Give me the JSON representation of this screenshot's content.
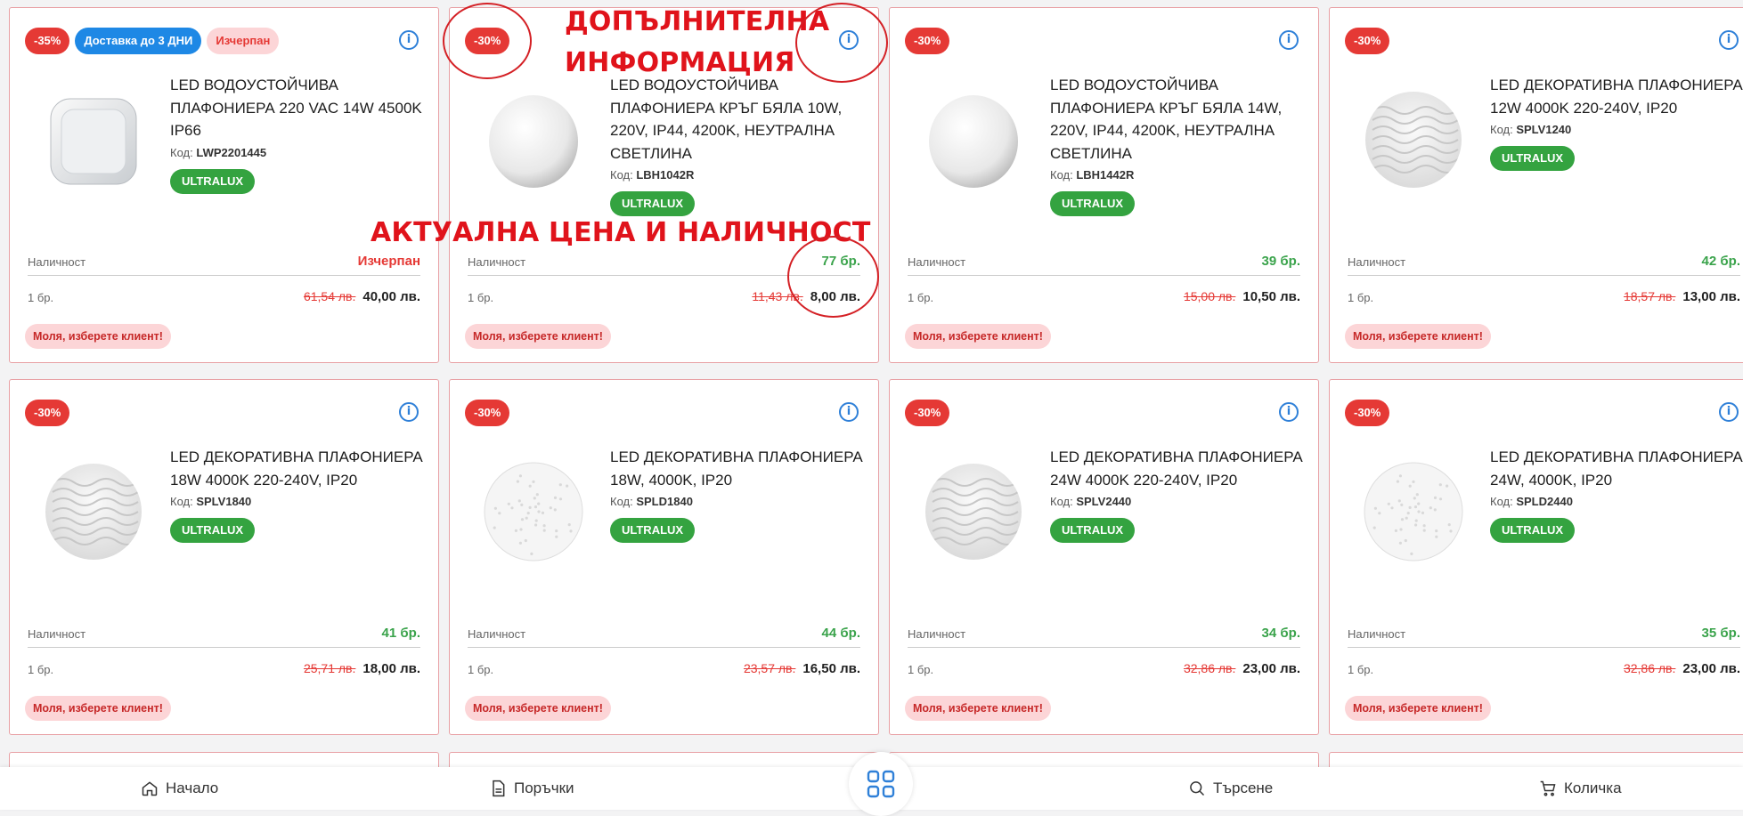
{
  "common": {
    "stock_label": "Наличност",
    "qty": "1 бр.",
    "client_prompt": "Моля, изберете клиент!",
    "code_label": "Код:",
    "info_glyph": "i"
  },
  "annotations": {
    "more_info": "ДОПЪЛНИТЕЛНА ИНФОРМАЦИЯ",
    "more_info_line1": "ДОПЪЛНИТЕЛНА",
    "more_info_line2": "ИНФОРМАЦИЯ",
    "price_stock": "АКТУАЛНА ЦЕНА И НАЛИЧНОСТ"
  },
  "products": [
    {
      "badges": [
        {
          "text": "-35%",
          "kind": "discount"
        },
        {
          "text": "Доставка до 3 ДНИ",
          "kind": "delivery"
        },
        {
          "text": "Изчерпан",
          "kind": "soldout"
        }
      ],
      "title": "LED ВОДОУСТОЙЧИВА ПЛАФОНИЕРА 220 VAC 14W 4500K IP66",
      "code": "LWP2201445",
      "brand": "ULTRALUX",
      "stock": "Изчерпан",
      "stock_out": true,
      "old_price": "61,54 лв.",
      "price": "40,00 лв.",
      "image": "square-lamp-icon"
    },
    {
      "badges": [
        {
          "text": "-30%",
          "kind": "discount"
        }
      ],
      "title": "LED ВОДОУСТОЙЧИВА ПЛАФОНИЕРА КРЪГ БЯЛА 10W, 220V, IP44, 4200K, НЕУТРАЛНА СВЕТЛИНА",
      "code": "LBH1042R",
      "brand": "ULTRALUX",
      "stock": "77 бр.",
      "stock_out": false,
      "old_price": "11,43 лв.",
      "price": "8,00 лв.",
      "image": "round-lamp-icon"
    },
    {
      "badges": [
        {
          "text": "-30%",
          "kind": "discount"
        }
      ],
      "title": "LED ВОДОУСТОЙЧИВА ПЛАФОНИЕРА КРЪГ БЯЛА 14W, 220V, IP44, 4200K, НЕУТРАЛНА СВЕТЛИНА",
      "code": "LBH1442R",
      "brand": "ULTRALUX",
      "stock": "39 бр.",
      "stock_out": false,
      "old_price": "15,00 лв.",
      "price": "10,50 лв.",
      "image": "round-lamp-icon"
    },
    {
      "badges": [
        {
          "text": "-30%",
          "kind": "discount"
        }
      ],
      "title": "LED ДЕКОРАТИВНА ПЛАФОНИЕРА 12W 4000K 220-240V, IP20",
      "code": "SPLV1240",
      "brand": "ULTRALUX",
      "stock": "42 бр.",
      "stock_out": false,
      "old_price": "18,57 лв.",
      "price": "13,00 лв.",
      "image": "wave-lamp-icon"
    },
    {
      "badges": [
        {
          "text": "-30%",
          "kind": "discount"
        }
      ],
      "title": "LED ДЕКОРАТИВНА ПЛАФОНИЕРА 18W 4000K 220-240V, IP20",
      "code": "SPLV1840",
      "brand": "ULTRALUX",
      "stock": "41 бр.",
      "stock_out": false,
      "old_price": "25,71 лв.",
      "price": "18,00 лв.",
      "image": "wave-lamp-icon"
    },
    {
      "badges": [
        {
          "text": "-30%",
          "kind": "discount"
        }
      ],
      "title": "LED ДЕКОРАТИВНА ПЛАФОНИЕРА 18W, 4000K, IP20",
      "code": "SPLD1840",
      "brand": "ULTRALUX",
      "stock": "44 бр.",
      "stock_out": false,
      "old_price": "23,57 лв.",
      "price": "16,50 лв.",
      "image": "sparkle-lamp-icon"
    },
    {
      "badges": [
        {
          "text": "-30%",
          "kind": "discount"
        }
      ],
      "title": "LED ДЕКОРАТИВНА ПЛАФОНИЕРА 24W 4000K 220-240V, IP20",
      "code": "SPLV2440",
      "brand": "ULTRALUX",
      "stock": "34 бр.",
      "stock_out": false,
      "old_price": "32,86 лв.",
      "price": "23,00 лв.",
      "image": "wave-lamp-icon"
    },
    {
      "badges": [
        {
          "text": "-30%",
          "kind": "discount"
        }
      ],
      "title": "LED ДЕКОРАТИВНА ПЛАФОНИЕРА 24W, 4000K, IP20",
      "code": "SPLD2440",
      "brand": "ULTRALUX",
      "stock": "35 бр.",
      "stock_out": false,
      "old_price": "32,86 лв.",
      "price": "23,00 лв.",
      "image": "sparkle-lamp-icon"
    }
  ],
  "nav": {
    "home": "Начало",
    "orders": "Поръчки",
    "search": "Търсене",
    "cart": "Количка"
  },
  "colors": {
    "accent_red": "#e53935",
    "green": "#34a340",
    "blue": "#1e88e5"
  }
}
